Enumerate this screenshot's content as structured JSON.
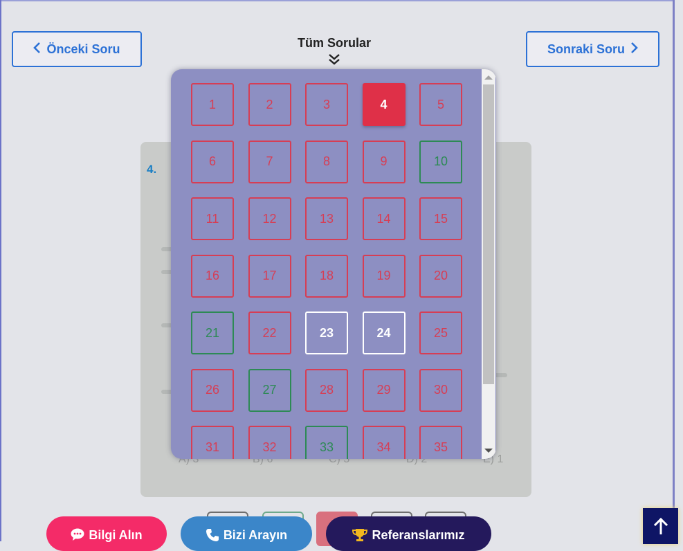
{
  "nav": {
    "prev_label": "Önceki Soru",
    "next_label": "Sonraki Soru",
    "all_questions_label": "Tüm Sorular"
  },
  "question": {
    "number_label": "4.",
    "options": [
      "A) 3",
      "B) 6",
      "C) 5",
      "D) 2",
      "E) 1"
    ]
  },
  "question_grid": {
    "active": "4",
    "cells": [
      {
        "label": "1",
        "state": "red"
      },
      {
        "label": "2",
        "state": "red"
      },
      {
        "label": "3",
        "state": "red"
      },
      {
        "label": "4",
        "state": "active"
      },
      {
        "label": "5",
        "state": "red"
      },
      {
        "label": "6",
        "state": "red"
      },
      {
        "label": "7",
        "state": "red"
      },
      {
        "label": "8",
        "state": "red"
      },
      {
        "label": "9",
        "state": "red"
      },
      {
        "label": "10",
        "state": "green"
      },
      {
        "label": "11",
        "state": "red"
      },
      {
        "label": "12",
        "state": "red"
      },
      {
        "label": "13",
        "state": "red"
      },
      {
        "label": "14",
        "state": "red"
      },
      {
        "label": "15",
        "state": "red"
      },
      {
        "label": "16",
        "state": "red"
      },
      {
        "label": "17",
        "state": "red"
      },
      {
        "label": "18",
        "state": "red"
      },
      {
        "label": "19",
        "state": "red"
      },
      {
        "label": "20",
        "state": "red"
      },
      {
        "label": "21",
        "state": "green"
      },
      {
        "label": "22",
        "state": "red"
      },
      {
        "label": "23",
        "state": "white"
      },
      {
        "label": "24",
        "state": "white"
      },
      {
        "label": "25",
        "state": "red"
      },
      {
        "label": "26",
        "state": "red"
      },
      {
        "label": "27",
        "state": "green"
      },
      {
        "label": "28",
        "state": "red"
      },
      {
        "label": "29",
        "state": "red"
      },
      {
        "label": "30",
        "state": "red"
      },
      {
        "label": "31",
        "state": "red"
      },
      {
        "label": "32",
        "state": "red"
      },
      {
        "label": "33",
        "state": "green"
      },
      {
        "label": "34",
        "state": "red"
      },
      {
        "label": "35",
        "state": "red"
      }
    ]
  },
  "footer": {
    "info_label": "Bilgi Alın",
    "call_label": "Bizi Arayın",
    "references_label": "Referanslarımız"
  },
  "colors": {
    "accent_blue": "#2c71d6",
    "wrong_red": "#d63e55",
    "correct_green": "#2d8a55",
    "panel_bg": "#8d8fc2",
    "info_pink": "#f42b68",
    "call_blue": "#3b86c9",
    "ref_navy": "#24195c"
  },
  "icons": {
    "prev": "chevron-left-icon",
    "next": "chevron-right-icon",
    "expand": "double-chevron-down-icon",
    "info": "chat-bubble-icon",
    "call": "phone-icon",
    "references": "trophy-icon",
    "to_top": "arrow-up-icon"
  }
}
